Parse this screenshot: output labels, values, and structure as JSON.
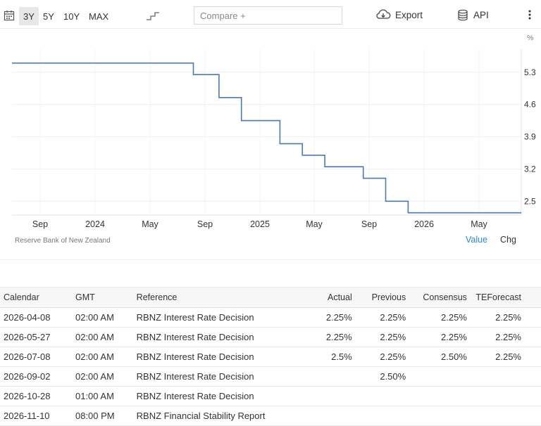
{
  "toolbar": {
    "ranges": [
      "3Y",
      "5Y",
      "10Y",
      "MAX"
    ],
    "active_range": "3Y",
    "compare_placeholder": "Compare +",
    "export_label": "Export",
    "api_label": "API",
    "icons": [
      "calendar-icon",
      "step-chart-icon",
      "cloud-download-icon",
      "database-icon",
      "kebab-menu-icon"
    ]
  },
  "chart_data": {
    "type": "line",
    "step": true,
    "unit_label": "%",
    "line_color": "#4a7ab5",
    "x_tick_labels": [
      "Sep",
      "2024",
      "May",
      "Sep",
      "2025",
      "May",
      "Sep",
      "2026",
      "May"
    ],
    "y_ticks": [
      5.3,
      4.6,
      3.9,
      3.2,
      2.5
    ],
    "ylim": [
      2.2,
      5.8
    ],
    "xlim": [
      "2023-07-15",
      "2026-07-31"
    ],
    "grid": true,
    "x": [
      "2023-07-15",
      "2024-08-14",
      "2024-10-09",
      "2024-11-27",
      "2025-02-19",
      "2025-04-09",
      "2025-05-28",
      "2025-08-20",
      "2025-10-08",
      "2025-11-26",
      "2026-07-31"
    ],
    "y": [
      5.5,
      5.25,
      4.75,
      4.25,
      3.75,
      3.5,
      3.25,
      3.0,
      2.5,
      2.25,
      2.25
    ]
  },
  "source": "Reserve Bank of New Zealand",
  "view_toggle": {
    "value_label": "Value",
    "chg_label": "Chg",
    "active": "Value",
    "active_color": "#2a8ad0"
  },
  "calendar": {
    "headers": [
      "Calendar",
      "GMT",
      "Reference",
      "Actual",
      "Previous",
      "Consensus",
      "TEForecast"
    ],
    "rows": [
      [
        "2026-04-08",
        "02:00 AM",
        "RBNZ Interest Rate Decision",
        "2.25%",
        "2.25%",
        "2.25%",
        "2.25%"
      ],
      [
        "2026-05-27",
        "02:00 AM",
        "RBNZ Interest Rate Decision",
        "2.25%",
        "2.25%",
        "2.25%",
        "2.25%"
      ],
      [
        "2026-07-08",
        "02:00 AM",
        "RBNZ Interest Rate Decision",
        "2.5%",
        "2.25%",
        "2.50%",
        "2.25%"
      ],
      [
        "2026-09-02",
        "02:00 AM",
        "RBNZ Interest Rate Decision",
        "",
        "2.50%",
        "",
        ""
      ],
      [
        "2026-10-28",
        "01:00 AM",
        "RBNZ Interest Rate Decision",
        "",
        "",
        "",
        ""
      ],
      [
        "2026-11-10",
        "08:00 PM",
        "RBNZ Financial Stability Report",
        "",
        "",
        "",
        ""
      ]
    ]
  }
}
